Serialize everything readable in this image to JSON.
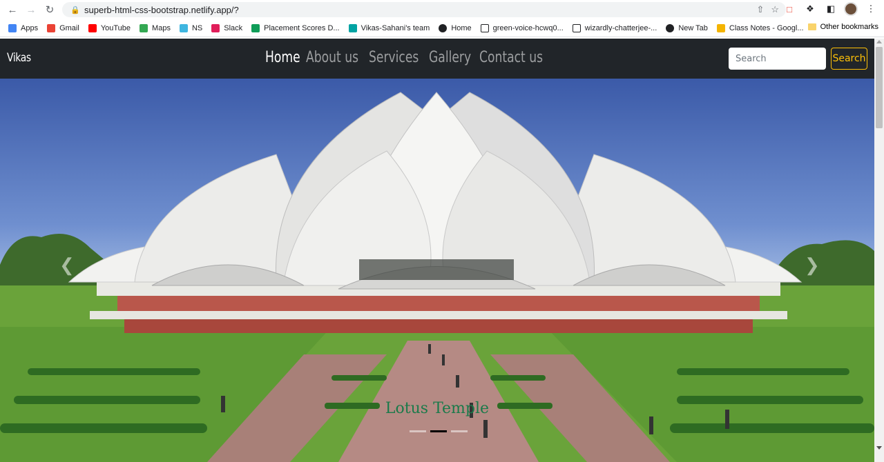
{
  "browser": {
    "url": "superb-html-css-bootstrap.netlify.app/?",
    "bookmarks": [
      {
        "label": "Apps",
        "icon": "apps-icon",
        "color": "#4285f4"
      },
      {
        "label": "Gmail",
        "icon": "gmail-icon",
        "color": "#ea4335"
      },
      {
        "label": "YouTube",
        "icon": "youtube-icon",
        "color": "#ff0000"
      },
      {
        "label": "Maps",
        "icon": "maps-icon",
        "color": "#34a853"
      },
      {
        "label": "NS",
        "icon": "ns-icon",
        "color": "#3fb6e0"
      },
      {
        "label": "Slack",
        "icon": "slack-icon",
        "color": "#e01e5a"
      },
      {
        "label": "Placement Scores D...",
        "icon": "sheets-icon",
        "color": "#0f9d58"
      },
      {
        "label": "Vikas-Sahani's team",
        "icon": "team-icon",
        "color": "#00a3a3"
      },
      {
        "label": "Home",
        "icon": "globe-icon",
        "color": "#202124"
      },
      {
        "label": "green-voice-hcwq0...",
        "icon": "page-icon",
        "color": "#202124"
      },
      {
        "label": "wizardly-chatterjee-...",
        "icon": "page-icon",
        "color": "#202124"
      },
      {
        "label": "New Tab",
        "icon": "globe-icon",
        "color": "#202124"
      },
      {
        "label": "Class Notes - Googl...",
        "icon": "slides-icon",
        "color": "#f4b400"
      }
    ],
    "other_bookmarks": "Other bookmarks"
  },
  "navbar": {
    "brand": "Vikas",
    "links": [
      "Home",
      "About us",
      "Services",
      "Gallery",
      "Contact us"
    ],
    "active_link": "Home",
    "search_placeholder": "Search",
    "search_button": "Search",
    "accent_color": "#ffc107"
  },
  "hero": {
    "caption": "Lotus Temple",
    "slide_count": 3,
    "active_slide": 2
  }
}
